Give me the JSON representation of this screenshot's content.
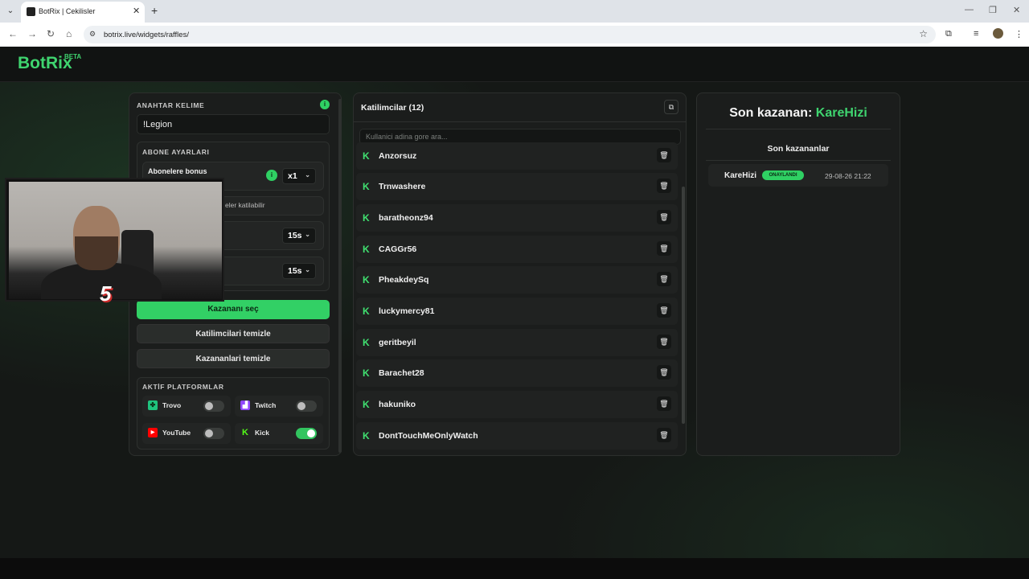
{
  "browser": {
    "tab_title": "BotRix | Cekilisler",
    "url": "botrix.live/widgets/raffles/",
    "new_tab": "+",
    "tab_close": "✕"
  },
  "brand": {
    "logo": "BotRix",
    "beta": "BETA"
  },
  "settings": {
    "keyword_label": "ANAHTAR KELIME",
    "keyword_value": "!Legion",
    "sub_settings_label": "ABONE AYARLARI",
    "sub_bonus_label": "Abonelere bonus",
    "sub_bonus_value": "x1",
    "sub_only_partial": "eler katilabilir",
    "duration_1": "15s",
    "duration_2": "15s"
  },
  "buttons": {
    "pick_winner": "Kazananı seç",
    "clear_participants": "Katilimcilari temizle",
    "clear_winners": "Kazananlari temizle"
  },
  "platforms": {
    "label": "AKTİF PLATFORMLAR",
    "items": [
      {
        "name": "Trovo",
        "enabled": false,
        "color": "#1fc37e"
      },
      {
        "name": "Twitch",
        "enabled": false,
        "color": "#9146ff"
      },
      {
        "name": "YouTube",
        "enabled": false,
        "color": "#ff0000"
      },
      {
        "name": "Kick",
        "enabled": true,
        "color": "#53fc18"
      }
    ]
  },
  "participants": {
    "title": "Katilimcilar (12)",
    "search_placeholder": "Kullanici adina gore ara...",
    "items": [
      "Anzorsuz",
      "Trnwashere",
      "baratheonz94",
      "CAGGr56",
      "PheakdeySq",
      "luckymercy81",
      "geritbeyil",
      "Barachet28",
      "hakuniko",
      "DontTouchMeOnlyWatch"
    ]
  },
  "winners": {
    "title_prefix": "Son kazanan: ",
    "last_winner": "KareHizi",
    "list_title": "Son kazananlar",
    "items": [
      {
        "name": "KareHizi",
        "status": "ONAYLANDI",
        "date": "29-08-26 21:22"
      }
    ]
  },
  "overlay": {
    "badge_text": "5"
  },
  "colors": {
    "accent": "#32d065",
    "background": "#151816",
    "panel": "#1b1d1c"
  }
}
